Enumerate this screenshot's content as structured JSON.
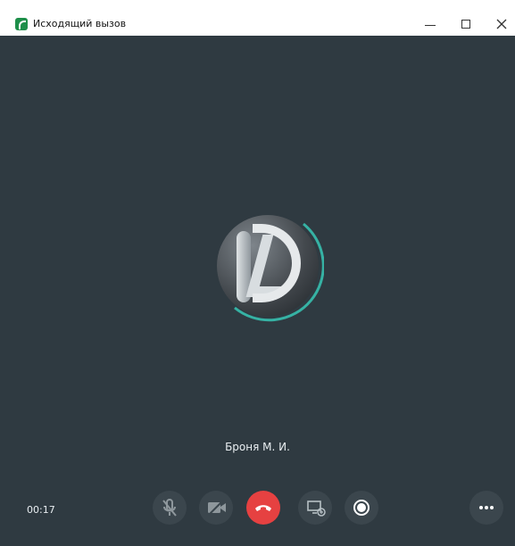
{
  "window": {
    "title": "Исходящий вызов",
    "controls": {
      "minimize": "minimize-icon",
      "maximize": "maximize-icon",
      "close": "close-icon"
    },
    "background": "#2f3a41",
    "accent": "#1e8f4a"
  },
  "call": {
    "contact_name": "Броня М. И.",
    "timer": "00:17",
    "controls": [
      "mute-microphone-icon",
      "video-off-icon",
      "end-call-icon",
      "screen-share-icon",
      "record-icon",
      "more-options-icon"
    ],
    "end_call_color": "#e64141",
    "ring_color": "#36b2a4"
  }
}
